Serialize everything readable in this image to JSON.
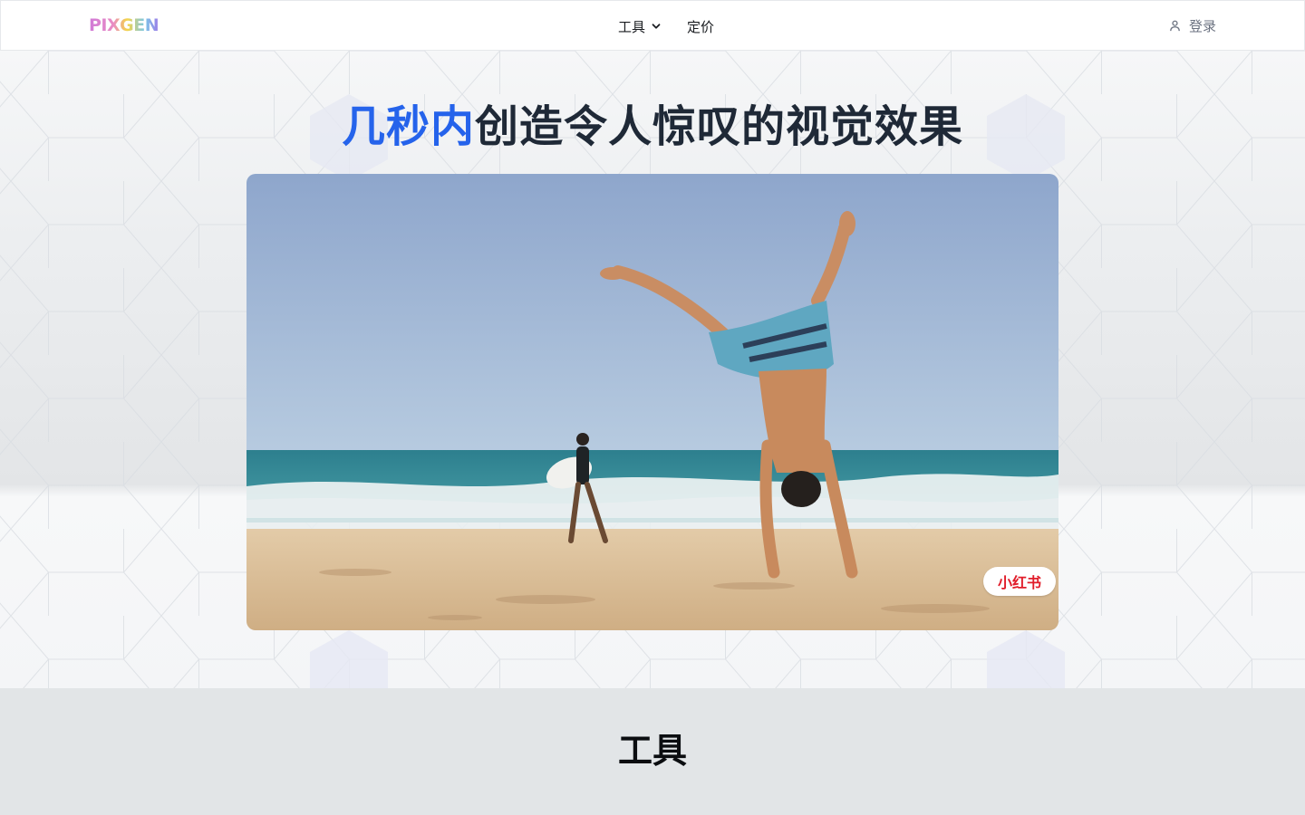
{
  "brand": {
    "logo_text": "PIXGEN"
  },
  "nav": {
    "items": [
      {
        "label": "工具",
        "has_dropdown": true
      },
      {
        "label": "定价",
        "has_dropdown": false
      }
    ],
    "login_label": "登录"
  },
  "hero": {
    "title_accent": "几秒内",
    "title_rest": "创造令人惊叹的视觉效果",
    "image_badge": "小红书"
  },
  "tools": {
    "heading": "工具"
  },
  "colors": {
    "accent": "#2563eb",
    "title_text": "#1f2937",
    "badge_text": "#e11d2a"
  }
}
